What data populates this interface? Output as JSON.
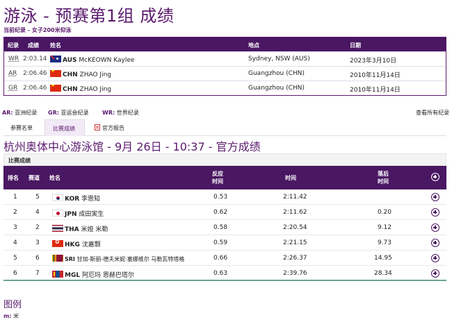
{
  "page_title": "游泳 - 预赛第1组 成绩",
  "current_record_label": "当前纪录 - 女子200米仰泳",
  "records": {
    "headers": [
      "纪录",
      "成绩",
      "姓名",
      "地点",
      "日期"
    ],
    "rows": [
      {
        "type": "WR",
        "time": "2:03.14",
        "flag": "aus",
        "noc": "AUS",
        "name": "McKEOWN Kaylee",
        "place": "Sydney, NSW (AUS)",
        "date": "2023年3月10日"
      },
      {
        "type": "AR",
        "time": "2:06.46",
        "flag": "chn",
        "noc": "CHN",
        "name": "ZHAO Jing",
        "place": "Guangzhou (CHN)",
        "date": "2010年11月14日"
      },
      {
        "type": "GR",
        "time": "2:06.46",
        "flag": "chn",
        "noc": "CHN",
        "name": "ZHAO Jing",
        "place": "Guangzhou (CHN)",
        "date": "2010年11月14日"
      }
    ]
  },
  "abbreviations": [
    {
      "code": "AR:",
      "text": "亚洲纪录"
    },
    {
      "code": "GR:",
      "text": "亚运会纪录"
    },
    {
      "code": "WR:",
      "text": "世界纪录"
    }
  ],
  "view_all_records": "查看所有纪录",
  "tabs": [
    {
      "label": "参赛名单",
      "active": false
    },
    {
      "label": "比赛成绩",
      "active": true
    },
    {
      "label": "官方报告",
      "active": false,
      "icon": "document-icon"
    }
  ],
  "venue_title": "杭州奥体中心游泳馆 - 9月 26日 - 10:37 - 官方成绩",
  "results": {
    "caption": "比赛成绩",
    "headers": {
      "rank": "排名",
      "lane": "赛道",
      "name": "姓名",
      "reaction": "反应\n时间",
      "time": "时间",
      "behind": "落后\n时间"
    },
    "rows": [
      {
        "rank": "1",
        "lane": "5",
        "flag": "kor",
        "noc": "KOR",
        "name": "李恩知",
        "reaction": "0.53",
        "time": "2:11.42",
        "behind": ""
      },
      {
        "rank": "2",
        "lane": "4",
        "flag": "jpn",
        "noc": "JPN",
        "name": "成田実生",
        "reaction": "0.62",
        "time": "2:11.62",
        "behind": "0.20"
      },
      {
        "rank": "3",
        "lane": "2",
        "flag": "tha",
        "noc": "THA",
        "name": "米娅 米勒",
        "reaction": "0.58",
        "time": "2:20.54",
        "behind": "9.12"
      },
      {
        "rank": "4",
        "lane": "3",
        "flag": "hkg",
        "noc": "HKG",
        "name": "沈嘉颢",
        "reaction": "0.59",
        "time": "2:21.15",
        "behind": "9.73"
      },
      {
        "rank": "5",
        "lane": "6",
        "flag": "sri",
        "noc": "SRI",
        "name": "甘加-斯丽-德夫米妮·塞娜维尔 马勒瓦特塔格",
        "reaction": "0.66",
        "time": "2:26.37",
        "behind": "14.95"
      },
      {
        "rank": "6",
        "lane": "7",
        "flag": "mgl",
        "noc": "MGL",
        "name": "阿厄玛 恩赫巴塔尔",
        "reaction": "0.63",
        "time": "2:39.76",
        "behind": "28.34"
      }
    ]
  },
  "legend": {
    "title": "图例",
    "items": [
      {
        "code": "m:",
        "text": "米"
      }
    ]
  }
}
